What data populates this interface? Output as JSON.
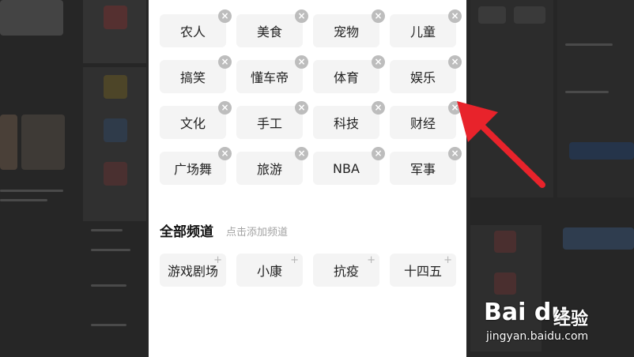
{
  "my_channels": [
    {
      "label": "农人"
    },
    {
      "label": "美食"
    },
    {
      "label": "宠物"
    },
    {
      "label": "儿童"
    },
    {
      "label": "搞笑"
    },
    {
      "label": "懂车帝"
    },
    {
      "label": "体育"
    },
    {
      "label": "娱乐"
    },
    {
      "label": "文化"
    },
    {
      "label": "手工"
    },
    {
      "label": "科技"
    },
    {
      "label": "财经"
    },
    {
      "label": "广场舞"
    },
    {
      "label": "旅游"
    },
    {
      "label": "NBA"
    },
    {
      "label": "军事"
    }
  ],
  "all_channels": {
    "title": "全部频道",
    "hint": "点击添加频道",
    "items": [
      {
        "label": "游戏剧场"
      },
      {
        "label": "小康"
      },
      {
        "label": "抗疫"
      },
      {
        "label": "十四五"
      }
    ]
  },
  "icons": {
    "remove": "×",
    "add": "+"
  },
  "watermark": {
    "logo": "Bai du",
    "text": "经验",
    "url": "jingyan.baidu.com"
  },
  "colors": {
    "arrow": "#e8232b",
    "chip_bg": "#f4f4f4",
    "remove_badge": "#bdbdbd"
  }
}
